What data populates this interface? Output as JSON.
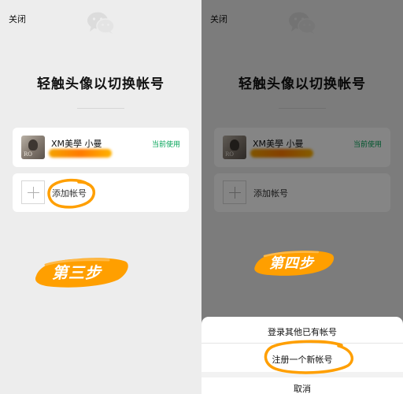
{
  "left": {
    "close_label": "关闭",
    "title": "轻触头像以切换帐号",
    "account": {
      "avatar_text": "RO",
      "name": "XM美學 小曼",
      "status": "当前使用"
    },
    "add_account_label": "添加帐号",
    "step_label": "第三步"
  },
  "right": {
    "close_label": "关闭",
    "title": "轻触头像以切换帐号",
    "account": {
      "avatar_text": "RO",
      "name": "XM美學 小曼",
      "status": "当前使用"
    },
    "add_account_label": "添加帐号",
    "step_label": "第四步",
    "sheet": {
      "login_other": "登录其他已有帐号",
      "register_new": "注册一个新帐号",
      "cancel": "取消"
    }
  },
  "colors": {
    "brand_green": "#07a55b",
    "highlight_orange": "#ff9f00",
    "background": "#ededed"
  },
  "icons": [
    "wechat-logo-icon",
    "plus-icon"
  ]
}
